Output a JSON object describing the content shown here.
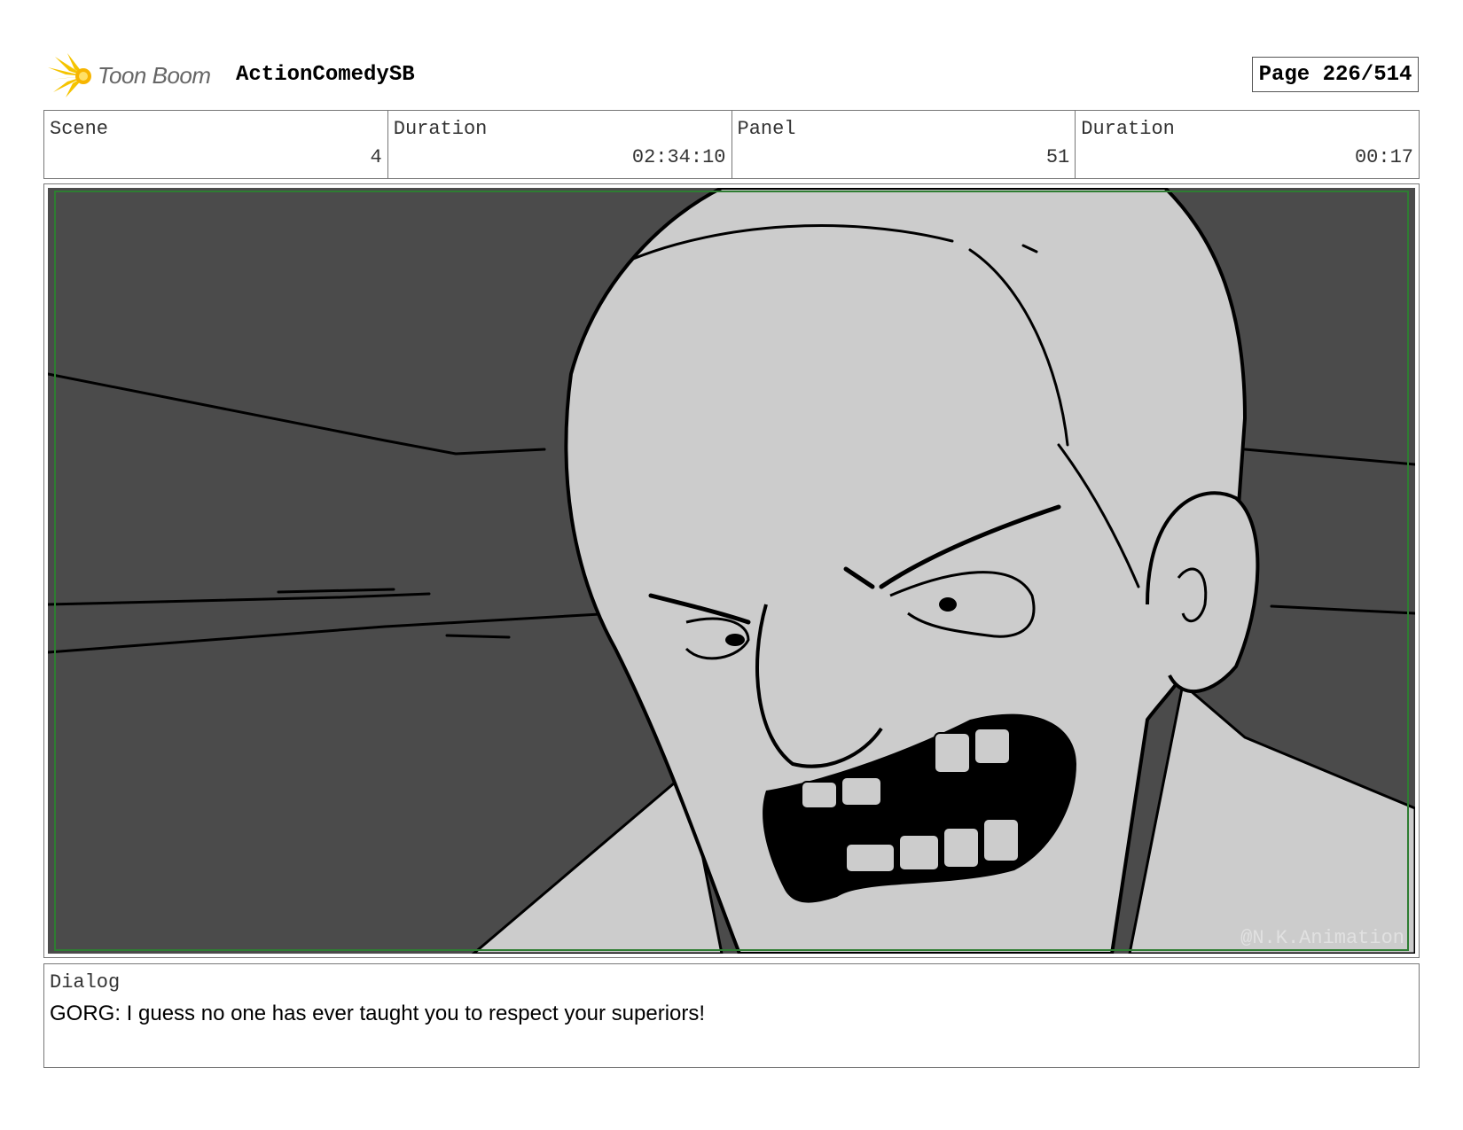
{
  "header": {
    "brand": "Toon Boom",
    "project": "ActionComedySB",
    "page": "Page 226/514"
  },
  "info": {
    "scene_label": "Scene",
    "scene_value": "4",
    "scene_duration_label": "Duration",
    "scene_duration_value": "02:34:10",
    "panel_label": "Panel",
    "panel_value": "51",
    "panel_duration_label": "Duration",
    "panel_duration_value": "00:17"
  },
  "panel_image": {
    "watermark": "@N.K.Animation",
    "background_color": "#4b4b4b",
    "skin_color": "#cccccc",
    "frame_color": "#2e7d32"
  },
  "dialog": {
    "label": "Dialog",
    "text": "GORG: I guess no one has ever taught you to respect your superiors!"
  },
  "icons": {
    "logo": "toon-boom-burst-icon"
  }
}
